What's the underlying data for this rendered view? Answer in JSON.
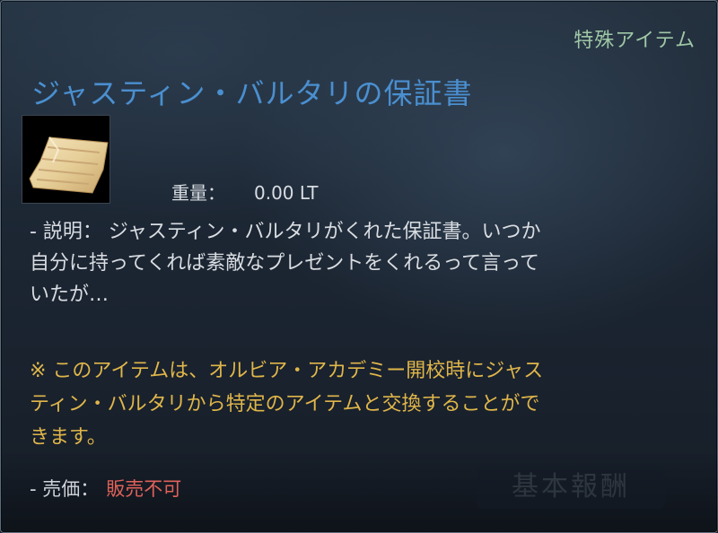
{
  "tooltip": {
    "category": "特殊アイテム",
    "title": "ジャスティン・バルタリの保証書",
    "icon": "paper-document-icon",
    "weight_label": "重量：",
    "weight_value": "0.00 LT",
    "description_line1": "- 説明： ジャスティン・バルタリがくれた保証書。いつか",
    "description_line2": "自分に持ってくれば素敵なプレゼントをくれるって言って",
    "description_line3": "いたが…",
    "notice_line1": "※ このアイテムは、オルビア・アカデミー開校時にジャス",
    "notice_line2": "ティン・バルタリから特定のアイテムと交換することがで",
    "notice_line3": "きます。",
    "price_label": "- 売価：",
    "price_value": "販売不可",
    "ghost_button_label": "基本報酬"
  },
  "colors": {
    "title": "#4a8fd0",
    "category": "#9fc7a6",
    "notice": "#e0b64a",
    "price_value": "#e0625a"
  }
}
